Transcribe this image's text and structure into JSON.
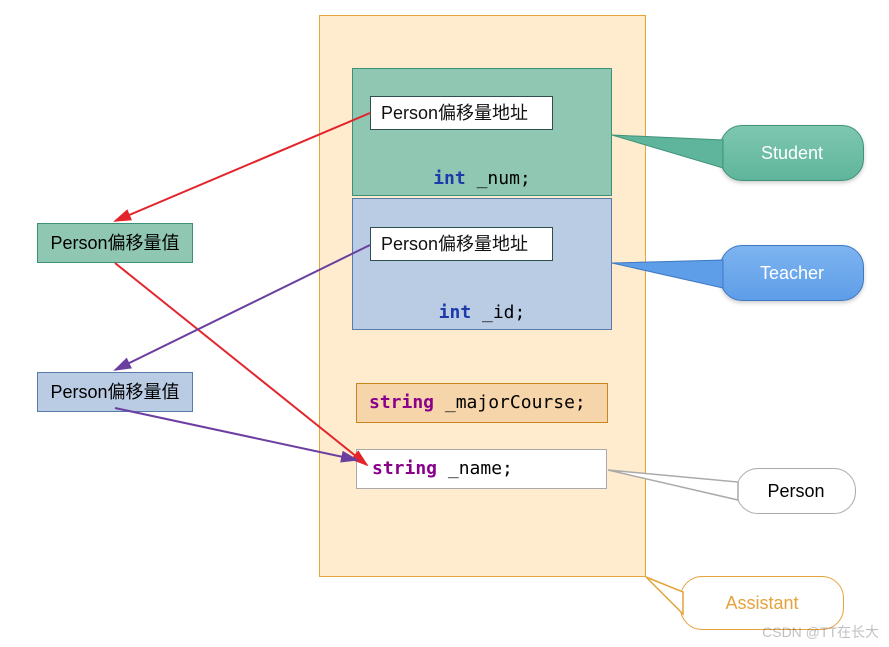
{
  "main": {
    "student": {
      "addr_label": "Person偏移量地址",
      "field_type": "int",
      "field_name": "_num;"
    },
    "teacher": {
      "addr_label": "Person偏移量地址",
      "field_type": "int",
      "field_name": "_id;"
    },
    "major": {
      "type": "string",
      "name": "_majorCourse;"
    },
    "name": {
      "type": "string",
      "name": "_name;"
    }
  },
  "left": {
    "offset1": "Person偏移量值",
    "offset2": "Person偏移量值"
  },
  "callouts": {
    "student": "Student",
    "teacher": "Teacher",
    "person": "Person",
    "assistant": "Assistant"
  },
  "watermark": "CSDN @TT在长大",
  "colors": {
    "student_bg": "#8FC7B3",
    "teacher_bg": "#B9CCE4",
    "container_bg": "#FFEBCD",
    "orange_border": "#E6A23C",
    "arrow_red": "#E3242B",
    "arrow_purple": "#6B3FA0"
  }
}
